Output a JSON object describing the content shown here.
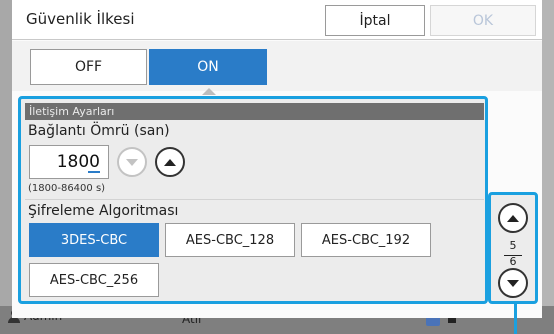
{
  "background": {
    "user_name": "Admin",
    "status": "Atıl"
  },
  "dialog": {
    "title": "Güvenlik İlkesi",
    "cancel_label": "İptal",
    "ok_label": "OK",
    "toggle": {
      "off_label": "OFF",
      "on_label": "ON",
      "selected": "ON"
    },
    "group_header": "İletişim Ayarları",
    "duration": {
      "label": "Bağlantı Ömrü (san)",
      "value": "1800",
      "range_hint": "(1800-86400 s)"
    },
    "algorithm": {
      "label": "Şifreleme Algoritması",
      "options": [
        "3DES-CBC",
        "AES-CBC_128",
        "AES-CBC_192",
        "AES-CBC_256"
      ],
      "selected": "3DES-CBC"
    },
    "pager": {
      "current": "5",
      "total": "6"
    }
  },
  "colors": {
    "accent": "#2a7cc8",
    "highlight": "#1aa0e0"
  }
}
